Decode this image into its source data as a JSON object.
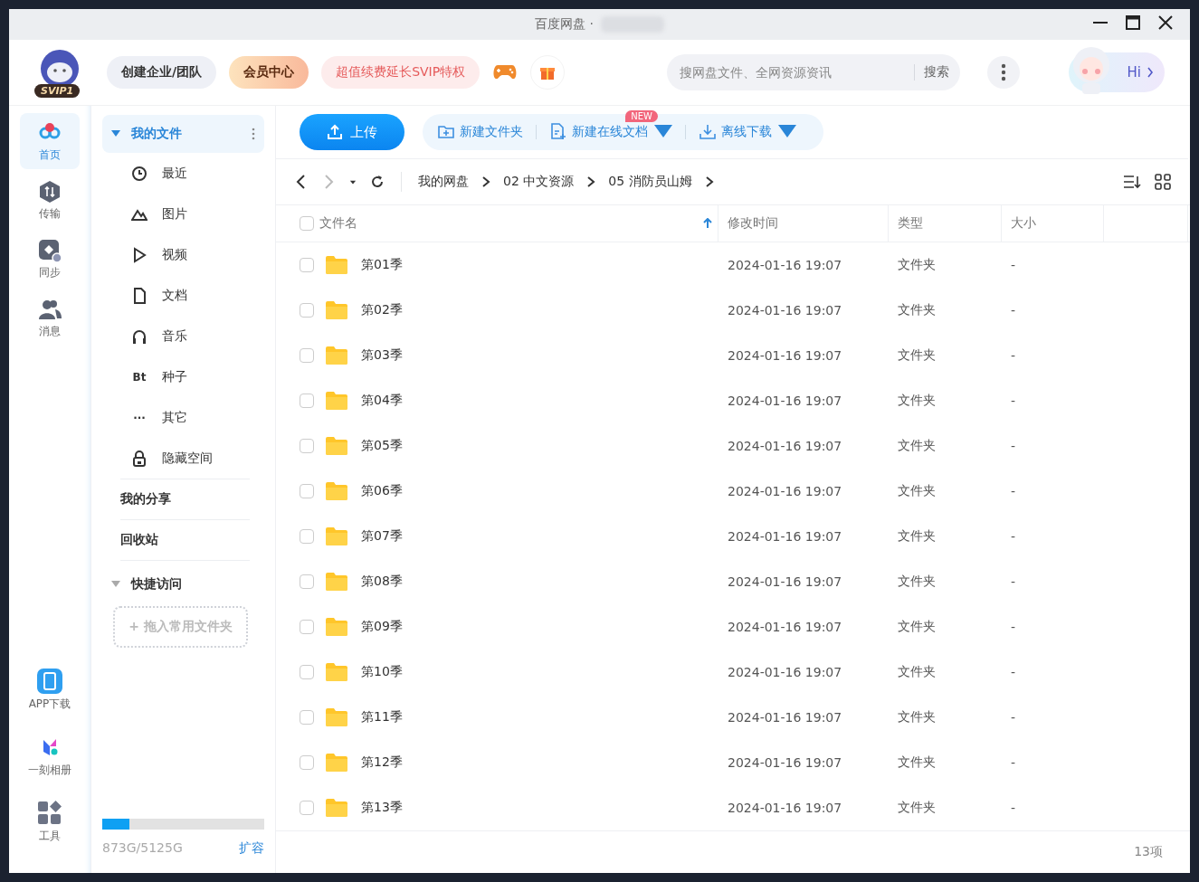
{
  "window": {
    "title": "百度网盘 ·"
  },
  "header": {
    "badge": "SVIP1",
    "buttons": [
      {
        "label": "创建企业/团队",
        "kind": "plain"
      },
      {
        "label": "会员中心",
        "kind": "vip"
      },
      {
        "label": "超值续费延长SVIP特权",
        "kind": "promo"
      }
    ],
    "search": {
      "placeholder": "搜网盘文件、全网资源资讯",
      "button": "搜索"
    },
    "greeting": "Hi"
  },
  "rail": {
    "items": [
      {
        "label": "首页",
        "kind": "home",
        "selected": true
      },
      {
        "label": "传输",
        "kind": "transfer",
        "selected": false
      },
      {
        "label": "同步",
        "kind": "sync",
        "selected": false
      },
      {
        "label": "消息",
        "kind": "message",
        "selected": false
      }
    ],
    "bottom_items": [
      {
        "label": "APP下载",
        "kind": "phone"
      },
      {
        "label": "一刻相册",
        "kind": "album"
      },
      {
        "label": "工具",
        "kind": "tools"
      }
    ]
  },
  "sidebar": {
    "my_files": {
      "label": "我的文件",
      "expanded": true,
      "selected": true,
      "items": [
        {
          "label": "最近",
          "kind": "recent"
        },
        {
          "label": "图片",
          "kind": "image"
        },
        {
          "label": "视频",
          "kind": "video"
        },
        {
          "label": "文档",
          "kind": "doc"
        },
        {
          "label": "音乐",
          "kind": "music"
        },
        {
          "label": "种子",
          "kind": "torrent",
          "glyph": "Bt"
        },
        {
          "label": "其它",
          "kind": "other",
          "glyph": "···"
        },
        {
          "label": "隐藏空间",
          "kind": "hidden"
        }
      ]
    },
    "links": [
      "我的分享",
      "回收站"
    ],
    "quick_access": {
      "label": "快捷访问",
      "expanded": true,
      "dropzone": "+ 拖入常用文件夹"
    },
    "storage": {
      "level": 0.167,
      "text": "873G/5125G",
      "action": "扩容"
    }
  },
  "toolbar": {
    "upload": "上传",
    "actions": [
      {
        "label": "新建文件夹",
        "kind": "folder",
        "caret": false
      },
      {
        "label": "新建在线文档",
        "kind": "doc",
        "caret": true,
        "badge": "NEW"
      },
      {
        "label": "离线下载",
        "kind": "download",
        "caret": true
      }
    ]
  },
  "breadcrumb": [
    "我的网盘",
    "02 中文资源",
    "05 消防员山姆"
  ],
  "table": {
    "select_all": {
      "checked": false
    },
    "columns": [
      {
        "label": "文件名",
        "sorted": true
      },
      {
        "label": "修改时间",
        "sorted": false
      },
      {
        "label": "类型",
        "sorted": false
      },
      {
        "label": "大小",
        "sorted": false
      }
    ],
    "rows": [
      {
        "name": "第01季",
        "modified": "2024-01-16 19:07",
        "type": "文件夹",
        "size": "-",
        "checked": false
      },
      {
        "name": "第02季",
        "modified": "2024-01-16 19:07",
        "type": "文件夹",
        "size": "-",
        "checked": false
      },
      {
        "name": "第03季",
        "modified": "2024-01-16 19:07",
        "type": "文件夹",
        "size": "-",
        "checked": false
      },
      {
        "name": "第04季",
        "modified": "2024-01-16 19:07",
        "type": "文件夹",
        "size": "-",
        "checked": false
      },
      {
        "name": "第05季",
        "modified": "2024-01-16 19:07",
        "type": "文件夹",
        "size": "-",
        "checked": false
      },
      {
        "name": "第06季",
        "modified": "2024-01-16 19:07",
        "type": "文件夹",
        "size": "-",
        "checked": false
      },
      {
        "name": "第07季",
        "modified": "2024-01-16 19:07",
        "type": "文件夹",
        "size": "-",
        "checked": false
      },
      {
        "name": "第08季",
        "modified": "2024-01-16 19:07",
        "type": "文件夹",
        "size": "-",
        "checked": false
      },
      {
        "name": "第09季",
        "modified": "2024-01-16 19:07",
        "type": "文件夹",
        "size": "-",
        "checked": false
      },
      {
        "name": "第10季",
        "modified": "2024-01-16 19:07",
        "type": "文件夹",
        "size": "-",
        "checked": false
      },
      {
        "name": "第11季",
        "modified": "2024-01-16 19:07",
        "type": "文件夹",
        "size": "-",
        "checked": false
      },
      {
        "name": "第12季",
        "modified": "2024-01-16 19:07",
        "type": "文件夹",
        "size": "-",
        "checked": false
      },
      {
        "name": "第13季",
        "modified": "2024-01-16 19:07",
        "type": "文件夹",
        "size": "-",
        "checked": false
      }
    ]
  },
  "status": "13项"
}
